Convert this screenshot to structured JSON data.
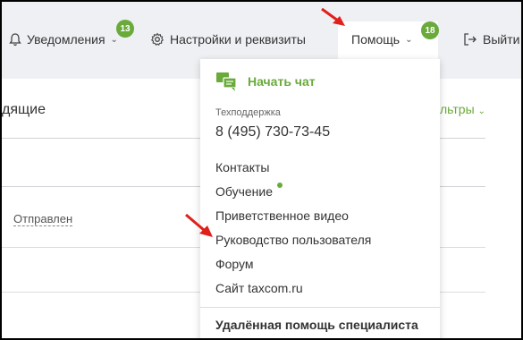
{
  "topbar": {
    "notifications": {
      "label": "Уведомления",
      "badge": "13"
    },
    "settings": {
      "label": "Настройки и реквизиты"
    },
    "help": {
      "label": "Помощь",
      "badge": "18"
    },
    "logout": {
      "label": "Выйти"
    }
  },
  "content": {
    "tab_label_partial": "дящие",
    "filters_partial": "льтры",
    "status_text": "Отправлен"
  },
  "help_menu": {
    "start_chat": "Начать чат",
    "support_heading": "Техподдержка",
    "support_phone": "8 (495) 730-73-45",
    "items": [
      {
        "label": "Контакты"
      },
      {
        "label": "Обучение"
      },
      {
        "label": "Приветственное видео"
      },
      {
        "label": "Руководство пользователя"
      },
      {
        "label": "Форум"
      },
      {
        "label": "Сайт taxcom.ru"
      }
    ],
    "remote_help": "Удалённая помощь специалиста"
  },
  "colors": {
    "accent_green": "#6aaa3b",
    "topbar_bg": "#eef0f3",
    "arrow_red": "#e0201b"
  }
}
